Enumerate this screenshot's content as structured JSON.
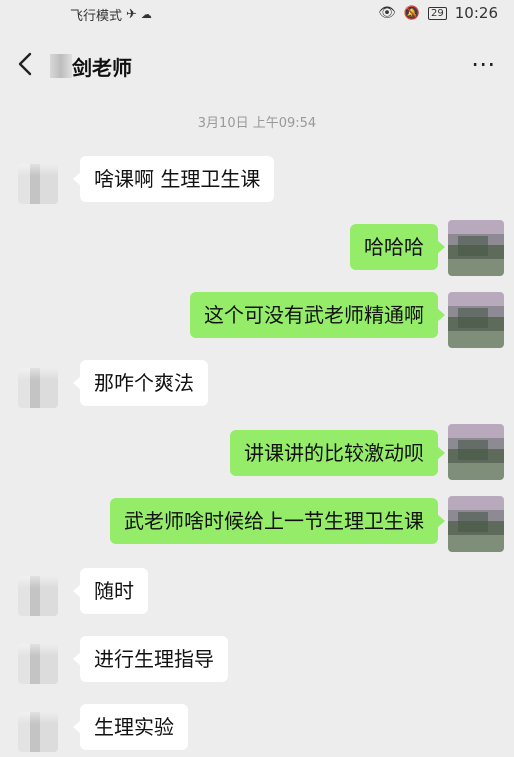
{
  "status_bar": {
    "airplane_mode_label": "飞行模式",
    "time": "10:26",
    "battery": "29"
  },
  "header": {
    "title": "剑老师",
    "more_label": "⋯"
  },
  "timestamp": "3月10日 上午09:54",
  "messages": [
    {
      "sender": "other",
      "text": "啥课啊 生理卫生课"
    },
    {
      "sender": "me",
      "text": "哈哈哈"
    },
    {
      "sender": "me",
      "text": "这个可没有武老师精通啊"
    },
    {
      "sender": "other",
      "text": "那咋个爽法"
    },
    {
      "sender": "me",
      "text": "讲课讲的比较激动呗"
    },
    {
      "sender": "me",
      "text": "武老师啥时候给上一节生理卫生课"
    },
    {
      "sender": "other",
      "text": "随时"
    },
    {
      "sender": "other",
      "text": "进行生理指导"
    },
    {
      "sender": "other",
      "text": "生理实验"
    }
  ],
  "colors": {
    "background": "#ededed",
    "my_bubble": "#95ec69",
    "other_bubble": "#ffffff",
    "timestamp_text": "#999999"
  }
}
